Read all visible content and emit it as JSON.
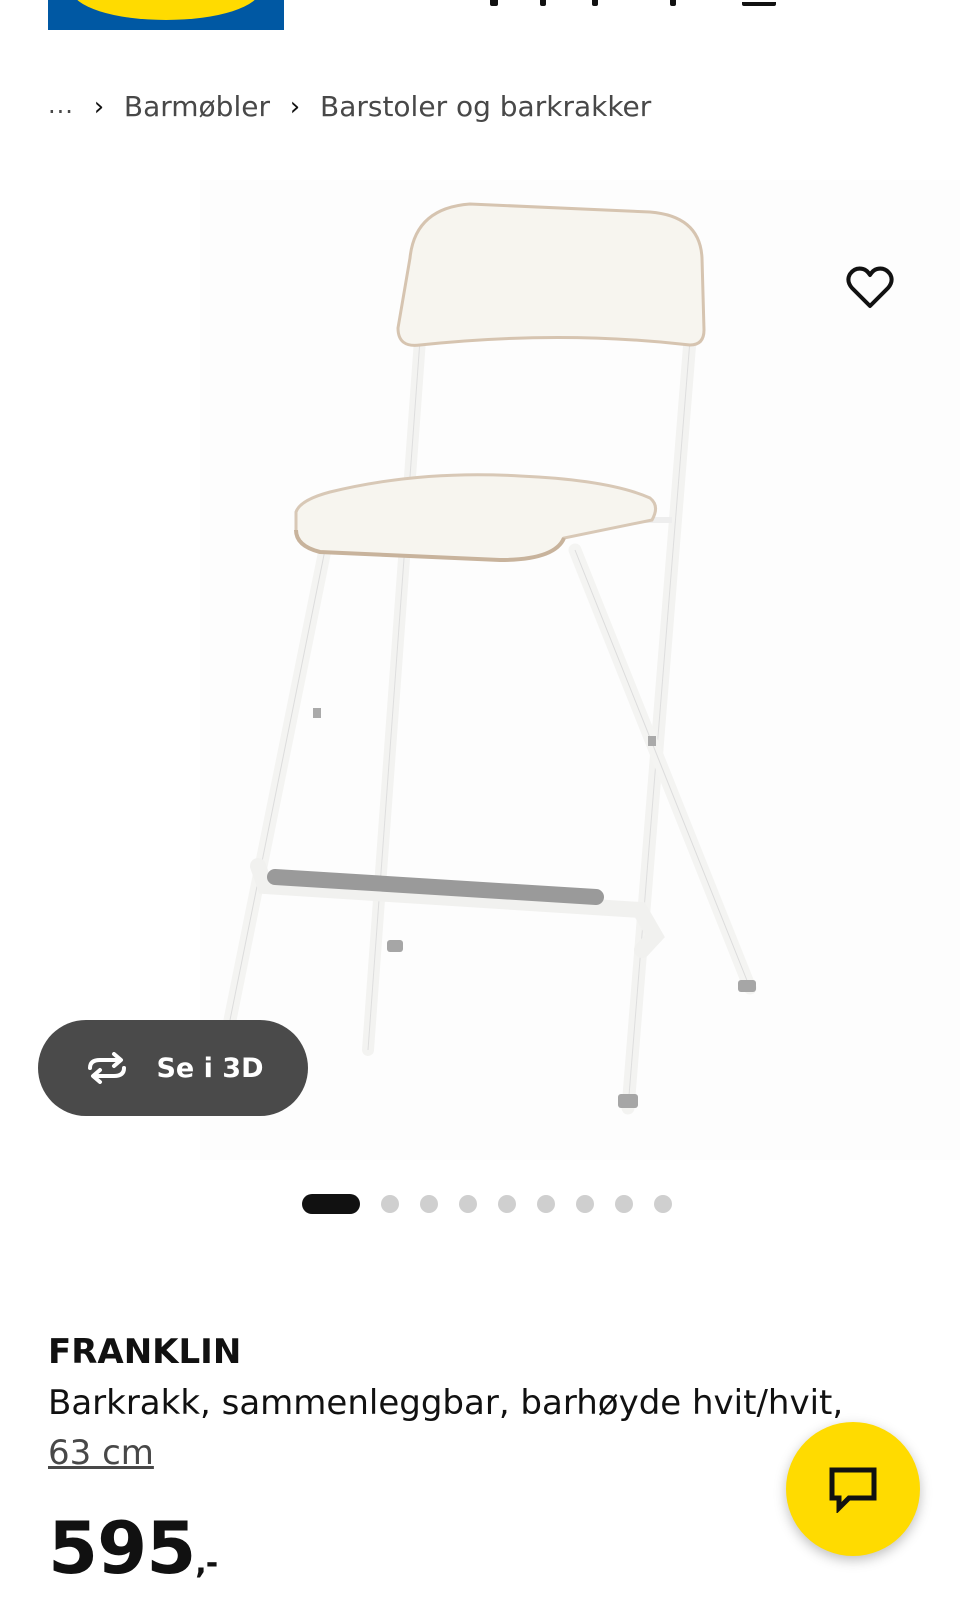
{
  "header": {
    "logo": "ikea-logo"
  },
  "breadcrumb": {
    "ellipsis": "...",
    "items": [
      "Barmøbler",
      "Barstoler og barkrakker"
    ]
  },
  "gallery": {
    "image": "franklin-bar-stool",
    "view3d_label": "Se i 3D",
    "image_count": 9,
    "active_index": 0
  },
  "product": {
    "name": "FRANKLIN",
    "description": "Barkrakk, sammenleggbar, barhøyde hvit/hvit,",
    "size_link": "63 cm",
    "price": "595",
    "price_suffix": ",-"
  },
  "icons": {
    "favorite": "heart-icon",
    "rotate": "rotate-3d-icon",
    "chat": "chat-icon"
  },
  "colors": {
    "brand_blue": "#0058a3",
    "brand_yellow": "#ffdb00",
    "pill_bg": "#4a4a4a"
  }
}
